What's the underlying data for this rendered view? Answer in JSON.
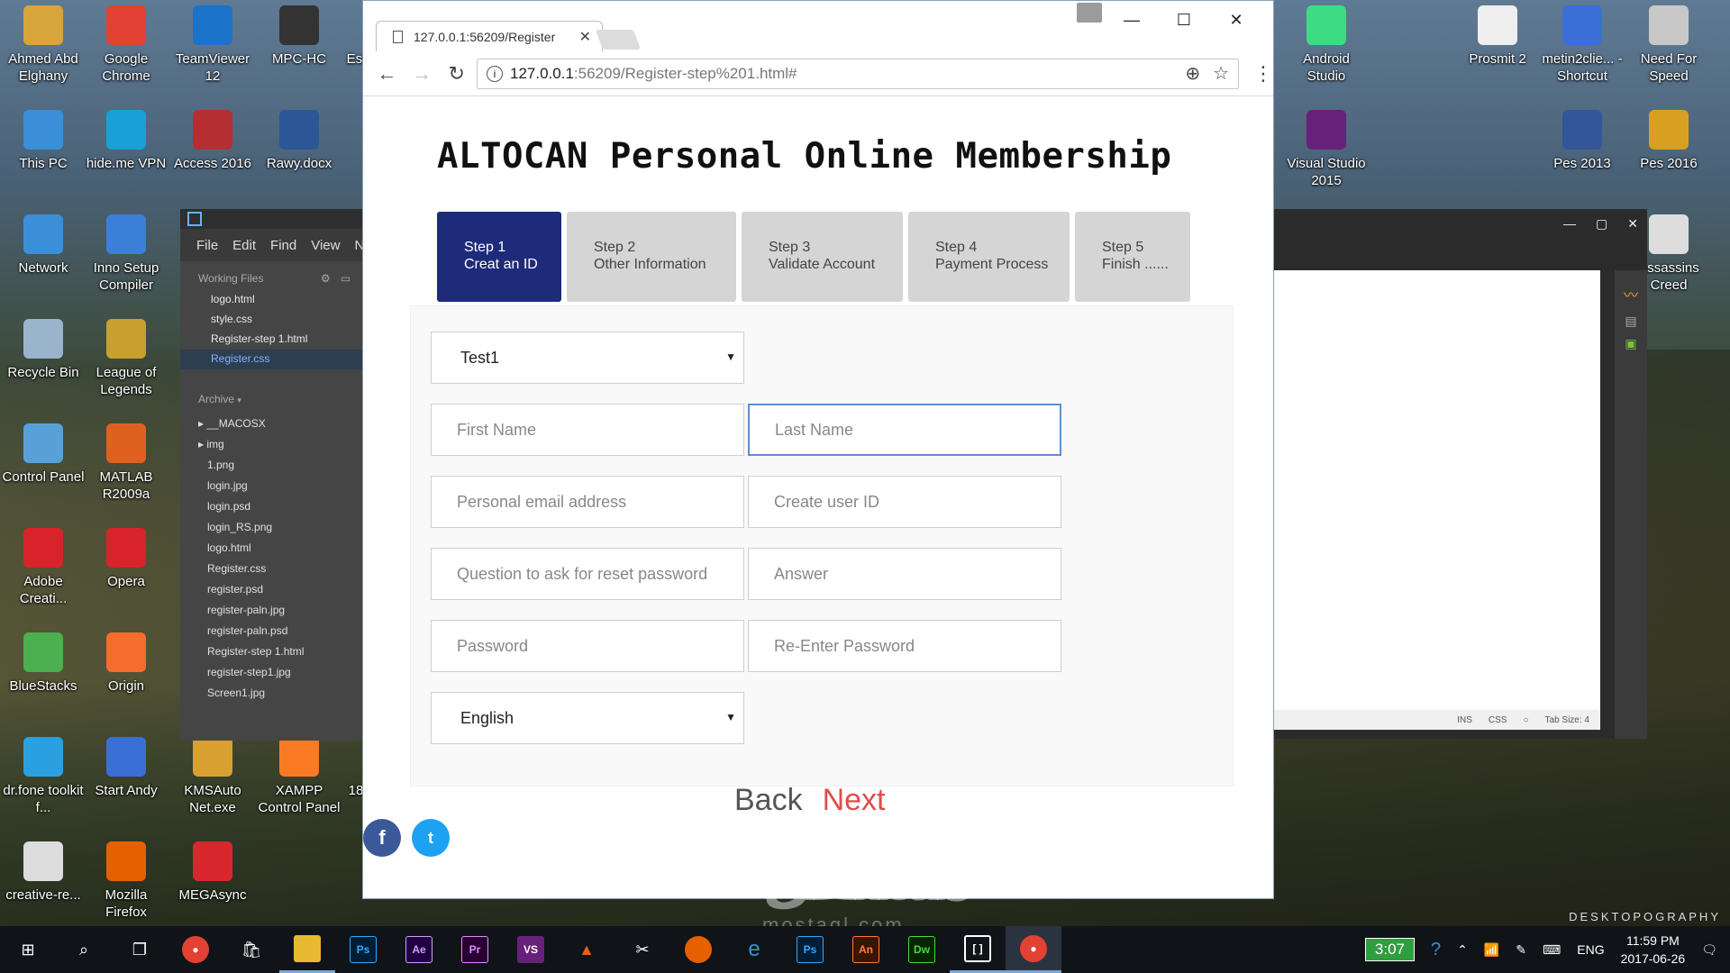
{
  "desktop_icons_left": [
    {
      "label": "Ahmed Abd Elghany",
      "icon": "folder-user-icon",
      "color": "#d8a53a"
    },
    {
      "label": "Google Chrome",
      "icon": "chrome-icon",
      "color": "#e34133"
    },
    {
      "label": "TeamViewer 12",
      "icon": "teamviewer-icon",
      "color": "#1a73c8"
    },
    {
      "label": "MPC-HC",
      "icon": "mpc-hc-icon",
      "color": "#333333"
    },
    {
      "label": "This PC",
      "icon": "this-pc-icon",
      "color": "#3a8fd8"
    },
    {
      "label": "hide.me VPN",
      "icon": "vpn-icon",
      "color": "#1aa0d8"
    },
    {
      "label": "Access 2016",
      "icon": "access-icon",
      "color": "#b52e31"
    },
    {
      "label": "Rawy.docx",
      "icon": "word-doc-icon",
      "color": "#2b5797"
    },
    {
      "label": "Network",
      "icon": "network-icon",
      "color": "#3a8fd8"
    },
    {
      "label": "Inno Setup Compiler",
      "icon": "inno-setup-icon",
      "color": "#3a7fd8"
    },
    {
      "label": "Recycle Bin",
      "icon": "recycle-bin-icon",
      "color": "#9ab4cc"
    },
    {
      "label": "League of Legends",
      "icon": "lol-icon",
      "color": "#c8a030"
    },
    {
      "label": "Control Panel",
      "icon": "control-panel-icon",
      "color": "#5aa0d8"
    },
    {
      "label": "MATLAB R2009a",
      "icon": "matlab-icon",
      "color": "#e06020"
    },
    {
      "label": "Adobe Creati...",
      "icon": "adobe-cc-icon",
      "color": "#d8232a"
    },
    {
      "label": "Opera",
      "icon": "opera-icon",
      "color": "#d8232a"
    },
    {
      "label": "BlueStacks",
      "icon": "bluestacks-icon",
      "color": "#4caf50"
    },
    {
      "label": "Origin",
      "icon": "origin-icon",
      "color": "#f56c2d"
    },
    {
      "label": "dr.fone toolkit f...",
      "icon": "drfone-icon",
      "color": "#2aa0e0"
    },
    {
      "label": "Start Andy",
      "icon": "andy-icon",
      "color": "#3a6fd8"
    },
    {
      "label": "KMSAuto Net.exe",
      "icon": "kmsauto-icon",
      "color": "#d8a030"
    },
    {
      "label": "XAMPP Control Panel",
      "icon": "xampp-icon",
      "color": "#fb7a24"
    },
    {
      "label": "creative-re...",
      "icon": "file-icon",
      "color": "#dddddd"
    },
    {
      "label": "Mozilla Firefox",
      "icon": "firefox-icon",
      "color": "#e66000"
    },
    {
      "label": "MEGAsync",
      "icon": "mega-icon",
      "color": "#d9272e"
    }
  ],
  "desktop_icons_right": [
    {
      "label": "Android Studio",
      "icon": "android-studio-icon",
      "color": "#3ddc84"
    },
    {
      "label": "Prosmit 2",
      "icon": "file-icon",
      "color": "#eeeeee"
    },
    {
      "label": "metin2clie... - Shortcut",
      "icon": "shortcut-icon",
      "color": "#3a6fd8"
    },
    {
      "label": "Need For Speed",
      "icon": "nfs-icon",
      "color": "#c8c8c8"
    },
    {
      "label": "Visual Studio 2015",
      "icon": "visual-studio-icon",
      "color": "#68217a"
    },
    {
      "label": "Pes 2013",
      "icon": "pes-icon",
      "color": "#335599"
    },
    {
      "label": "Pes 2016",
      "icon": "pes-icon",
      "color": "#d8a020"
    },
    {
      "label": "Assassins Creed",
      "icon": "assassins-creed-icon",
      "color": "#dddddd"
    }
  ],
  "desktop_partial_labels": [
    "Esl",
    "18"
  ],
  "brackets": {
    "menu": [
      "File",
      "Edit",
      "Find",
      "View",
      "N"
    ],
    "working_files_label": "Working Files",
    "working_files": [
      "logo.html",
      "style.css",
      "Register-step 1.html",
      "Register.css"
    ],
    "selected_file": "Register.css",
    "archive_label": "Archive",
    "archive_files": [
      "__MACOSX",
      "img",
      "1.png",
      "login.jpg",
      "login.psd",
      "login_RS.png",
      "logo.html",
      "Register.css",
      "register.psd",
      "register-paln.jpg",
      "register-paln.psd",
      "Register-step 1.html",
      "register-step1.jpg",
      "Screen1.jpg"
    ]
  },
  "editor_status": {
    "ins": "INS",
    "mode": "CSS",
    "tab_size": "Tab Size: 4"
  },
  "browser": {
    "tab_title": "127.0.0.1:56209/Register",
    "url_host": "127.0.0.1",
    "url_path": ":56209/Register-step%201.html#"
  },
  "page": {
    "title": "ALTOCAN Personal Online Membership",
    "steps": [
      {
        "line1": "Step 1",
        "line2": "Creat an ID",
        "active": true
      },
      {
        "line1": "Step 2",
        "line2": "Other Information",
        "active": false
      },
      {
        "line1": "Step 3",
        "line2": "Validate Account",
        "active": false
      },
      {
        "line1": "Step 4",
        "line2": "Payment Process",
        "active": false
      },
      {
        "line1": "Step 5",
        "line2": "Finish ......",
        "active": false
      }
    ],
    "form": {
      "select_top": "Test1",
      "first_name": "First Name",
      "last_name": "Last Name",
      "email": "Personal email address",
      "user_id": "Create user ID",
      "question": "Question to ask for reset password",
      "answer": "Answer",
      "password": "Password",
      "re_password": "Re-Enter Password",
      "language": "English"
    },
    "back_label": "Back",
    "next_label": "Next",
    "colors": {
      "active_step": "#1e2a7a",
      "next": "#e44b4b",
      "facebook": "#3b5998",
      "twitter": "#1da1f2"
    }
  },
  "watermark": {
    "main": "مستقل",
    "sub": "mostaql.com"
  },
  "wallpaper_brand": "DESKTOPOGRAPHY",
  "taskbar": {
    "gpu_temp": "3:07",
    "language": "ENG",
    "time": "11:59 PM",
    "date": "2017-06-26"
  }
}
